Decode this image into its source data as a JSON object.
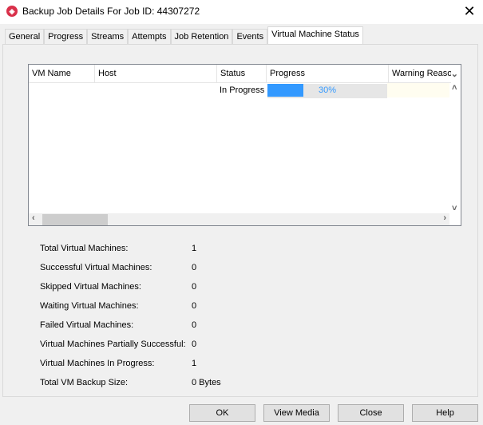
{
  "window": {
    "title": "Backup Job Details For Job ID: 44307272",
    "close": "✕"
  },
  "tabs": [
    {
      "label": "General"
    },
    {
      "label": "Progress"
    },
    {
      "label": "Streams"
    },
    {
      "label": "Attempts"
    },
    {
      "label": "Job Retention"
    },
    {
      "label": "Events"
    },
    {
      "label": "Virtual Machine Status"
    }
  ],
  "table": {
    "columns": [
      "VM Name",
      "Host",
      "Status",
      "Progress",
      "Warning Reason"
    ],
    "rows": [
      {
        "vm_name": "",
        "host": "",
        "status": "In Progress",
        "progress_percent": 30,
        "progress_label": "30%",
        "warning": ""
      }
    ]
  },
  "stats": [
    {
      "label": "Total Virtual Machines:",
      "value": "1"
    },
    {
      "label": "Successful Virtual Machines:",
      "value": "0"
    },
    {
      "label": "Skipped Virtual Machines:",
      "value": "0"
    },
    {
      "label": "Waiting Virtual Machines:",
      "value": "0"
    },
    {
      "label": "Failed Virtual Machines:",
      "value": "0"
    },
    {
      "label": "Virtual Machines Partially Successful:",
      "value": "0"
    },
    {
      "label": "Virtual Machines In Progress:",
      "value": "1"
    },
    {
      "label": "Total VM Backup Size:",
      "value": "0 Bytes"
    }
  ],
  "buttons": {
    "ok": "OK",
    "view_media": "View Media",
    "close": "Close",
    "help": "Help"
  }
}
